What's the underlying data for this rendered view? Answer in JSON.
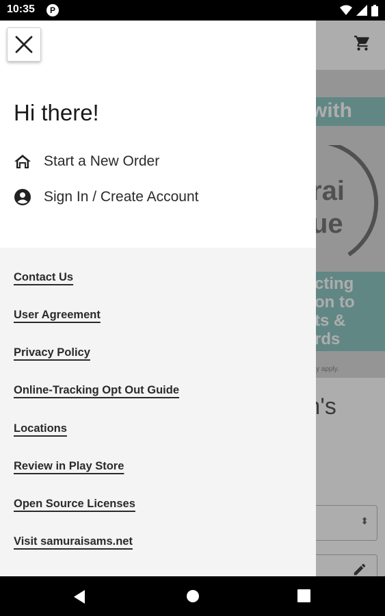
{
  "status_bar": {
    "time": "10:35",
    "app_icon_letter": "P",
    "icons": [
      "wifi-icon",
      "signal-icon",
      "battery-icon"
    ]
  },
  "background_app": {
    "promo_band_text": "with",
    "promo_lines": [
      "cting",
      "on to",
      "ts &",
      "rds"
    ],
    "fine_print": "y apply.",
    "title_fragment": "m's",
    "question_fragment": "?",
    "icons": [
      "cart-icon",
      "select-arrows-icon",
      "pencil-icon"
    ]
  },
  "drawer": {
    "close_icon": "close-icon",
    "greeting": "Hi there!",
    "actions": [
      {
        "label": "Start a New Order",
        "icon": "home-icon"
      },
      {
        "label": "Sign In / Create Account",
        "icon": "account-circle-icon"
      }
    ],
    "links": [
      "Contact Us",
      "User Agreement",
      "Privacy Policy",
      "Online-Tracking Opt Out Guide",
      "Locations",
      "Review in Play Store",
      "Open Source Licenses",
      "Visit samuraisams.net"
    ]
  },
  "nav_bar": {
    "buttons": [
      "back-icon",
      "home-circle-icon",
      "recents-icon"
    ]
  },
  "colors": {
    "promo_teal": "#8fc8c4",
    "drawer_top": "#ffffff",
    "drawer_bottom": "#f4f4f4",
    "text": "#2a2a2a"
  }
}
